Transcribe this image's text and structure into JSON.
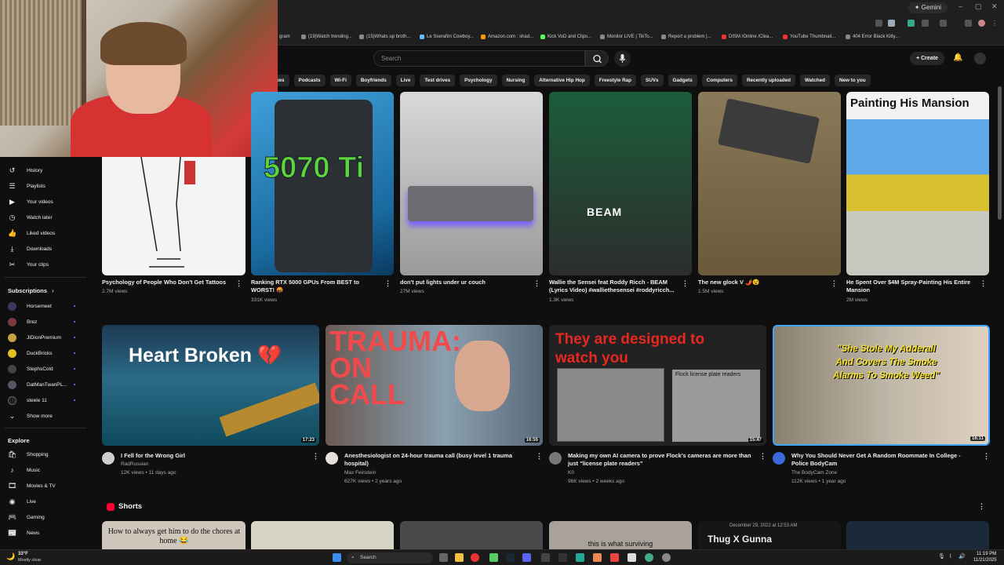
{
  "browser": {
    "gemini_label": "Gemini",
    "bookmarks": [
      "gram",
      "(19)Watch trending...",
      "(15)Whats up broth...",
      "Le Sserafim Cowboy...",
      "Amazon.com : shad...",
      "Kick VoD and Clips...",
      "Monitor LIVE | TikTo...",
      "Report a problem |...",
      "DISM /Online /Clea...",
      "YouTube Thumbnail...",
      "404 Error Black Kitty..."
    ]
  },
  "header": {
    "search_placeholder": "Search",
    "create_label": "Create"
  },
  "chips": [
    "xes",
    "Podcasts",
    "Wi-Fi",
    "Boyfriends",
    "Live",
    "Test drives",
    "Psychology",
    "Nursing",
    "Alternative Hip Hop",
    "Freestyle Rap",
    "SUVs",
    "Gadgets",
    "Computers",
    "Recently uploaded",
    "Watched",
    "New to you"
  ],
  "sidebar": {
    "you_items": [
      "History",
      "Playlists",
      "Your videos",
      "Watch later",
      "Liked videos",
      "Downloads",
      "Your clips"
    ],
    "subscriptions_title": "Subscriptions",
    "subscriptions": [
      "Horsemeet",
      "Brez",
      "JiDionPremium",
      "DuckBricks",
      "StephsCold",
      "DatManTwanPL...",
      "steele 11"
    ],
    "show_more": "Show more",
    "explore_title": "Explore",
    "explore_items": [
      "Shopping",
      "Music",
      "Movies & TV",
      "Live",
      "Gaming",
      "News"
    ]
  },
  "row1": [
    {
      "title": "Psychology of People Who Don't Get Tattoos",
      "views": "2.7M views"
    },
    {
      "title": "Ranking RTX 5000 GPUs From BEST to WORST! 🤬",
      "views": "331K views",
      "overlay": "5070 Ti"
    },
    {
      "title": "don't put lights under ur couch",
      "views": "27M views"
    },
    {
      "title": "Wallie the Sensei feat Roddy Ricch - BEAM (Lyrics Video) #walliethesensei #roddyricch...",
      "views": "1.3K views",
      "overlay": "BEAM"
    },
    {
      "title": "The new glock V 🌶️😵",
      "views": "1.5M views"
    },
    {
      "title": "He Spent Over $4M Spray-Painting His Entire Mansion",
      "views": "2M views",
      "overlay": "Painting His Mansion"
    }
  ],
  "row2": [
    {
      "title": "I Fell for the Wrong Girl",
      "channel": "RadRussian",
      "meta": "12K views • 11 days ago",
      "duration": "17:23",
      "overlay": "Heart Broken 💔"
    },
    {
      "title": "Anesthesiologist on 24-hour trauma call (busy level 1 trauma hospital)",
      "channel": "Max Feinstein",
      "meta": "627K views • 2 years ago",
      "duration": "16:55",
      "overlay": "TRAUMA: ON CALL"
    },
    {
      "title": "Making my own AI camera to prove Flock's cameras are more than just \"license plate readers\"",
      "channel": "K0",
      "meta": "96K views • 2 weeks ago",
      "duration": "15:47",
      "overlay": "They are designed to watch you",
      "overlay2": "Flock license plate readers"
    },
    {
      "title": "Why You Should Never Get A Random Roommate In College - Police BodyCam",
      "channel": "The BodyCam Zone",
      "meta": "112K views • 1 year ago",
      "duration": "16:11",
      "overlay": "\"She Stole My Adderall And Covers The Smoke Alarms To Smoke Weed\""
    }
  ],
  "shorts": {
    "title": "Shorts",
    "captions": [
      "How to always get him to do the chores at home 😂",
      "",
      "",
      "this is what surviving",
      "Thug X Gunna",
      ""
    ],
    "date_caption": "December 29, 2022 at 12:53 AM"
  },
  "taskbar": {
    "weather_temp": "33°F",
    "weather_desc": "Mostly clear",
    "search_label": "Search",
    "time": "11:19 PM",
    "date": "11/21/2025"
  }
}
